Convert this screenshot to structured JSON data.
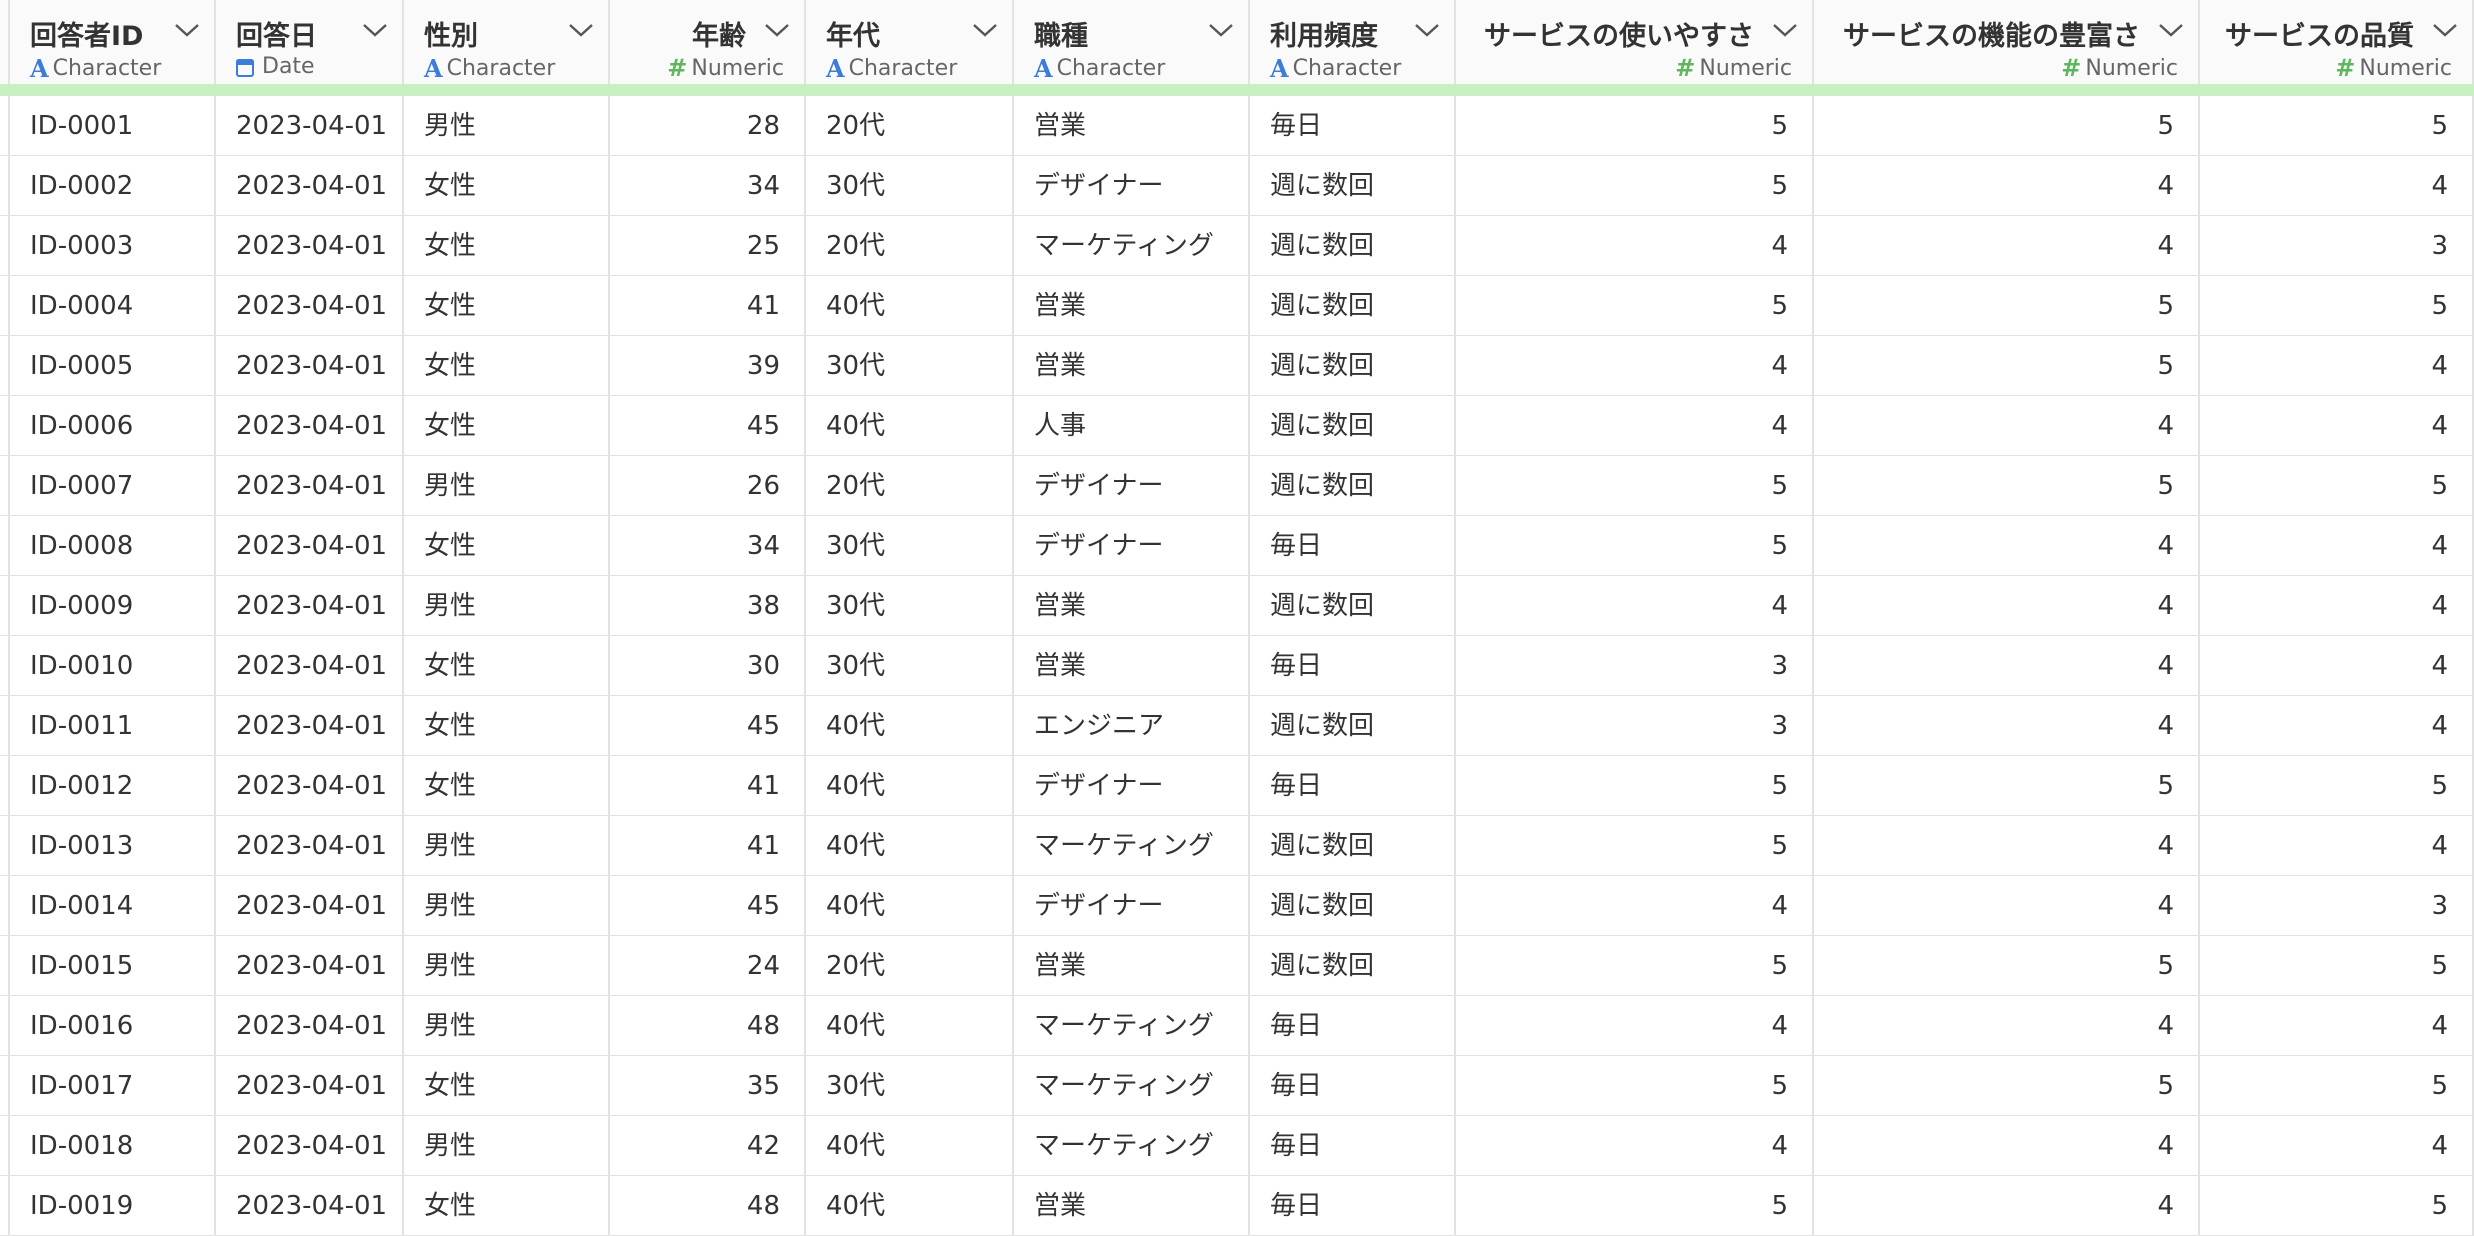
{
  "columns": [
    {
      "name": "回答者ID",
      "type": "Character",
      "icon": "character-icon",
      "align": "left"
    },
    {
      "name": "回答日",
      "type": "Date",
      "icon": "calendar-icon",
      "align": "left"
    },
    {
      "name": "性別",
      "type": "Character",
      "icon": "character-icon",
      "align": "left"
    },
    {
      "name": "年齢",
      "type": "Numeric",
      "icon": "numeric-icon",
      "align": "right"
    },
    {
      "name": "年代",
      "type": "Character",
      "icon": "character-icon",
      "align": "left"
    },
    {
      "name": "職種",
      "type": "Character",
      "icon": "character-icon",
      "align": "left"
    },
    {
      "name": "利用頻度",
      "type": "Character",
      "icon": "character-icon",
      "align": "left"
    },
    {
      "name": "サービスの使いやすさ",
      "type": "Numeric",
      "icon": "numeric-icon",
      "align": "right"
    },
    {
      "name": "サービスの機能の豊富さ",
      "type": "Numeric",
      "icon": "numeric-icon",
      "align": "right"
    },
    {
      "name": "サービスの品質",
      "type": "Numeric",
      "icon": "numeric-icon",
      "align": "right"
    }
  ],
  "type_icons": {
    "Character": "A",
    "Numeric": "#"
  },
  "colors": {
    "character": "#3b7dd8",
    "numeric": "#5db85d",
    "accent": "#c8f0c2"
  },
  "rows": [
    [
      "ID-0001",
      "2023-04-01",
      "男性",
      "28",
      "20代",
      "営業",
      "毎日",
      "5",
      "5",
      "5"
    ],
    [
      "ID-0002",
      "2023-04-01",
      "女性",
      "34",
      "30代",
      "デザイナー",
      "週に数回",
      "5",
      "4",
      "4"
    ],
    [
      "ID-0003",
      "2023-04-01",
      "女性",
      "25",
      "20代",
      "マーケティング",
      "週に数回",
      "4",
      "4",
      "3"
    ],
    [
      "ID-0004",
      "2023-04-01",
      "女性",
      "41",
      "40代",
      "営業",
      "週に数回",
      "5",
      "5",
      "5"
    ],
    [
      "ID-0005",
      "2023-04-01",
      "女性",
      "39",
      "30代",
      "営業",
      "週に数回",
      "4",
      "5",
      "4"
    ],
    [
      "ID-0006",
      "2023-04-01",
      "女性",
      "45",
      "40代",
      "人事",
      "週に数回",
      "4",
      "4",
      "4"
    ],
    [
      "ID-0007",
      "2023-04-01",
      "男性",
      "26",
      "20代",
      "デザイナー",
      "週に数回",
      "5",
      "5",
      "5"
    ],
    [
      "ID-0008",
      "2023-04-01",
      "女性",
      "34",
      "30代",
      "デザイナー",
      "毎日",
      "5",
      "4",
      "4"
    ],
    [
      "ID-0009",
      "2023-04-01",
      "男性",
      "38",
      "30代",
      "営業",
      "週に数回",
      "4",
      "4",
      "4"
    ],
    [
      "ID-0010",
      "2023-04-01",
      "女性",
      "30",
      "30代",
      "営業",
      "毎日",
      "3",
      "4",
      "4"
    ],
    [
      "ID-0011",
      "2023-04-01",
      "女性",
      "45",
      "40代",
      "エンジニア",
      "週に数回",
      "3",
      "4",
      "4"
    ],
    [
      "ID-0012",
      "2023-04-01",
      "女性",
      "41",
      "40代",
      "デザイナー",
      "毎日",
      "5",
      "5",
      "5"
    ],
    [
      "ID-0013",
      "2023-04-01",
      "男性",
      "41",
      "40代",
      "マーケティング",
      "週に数回",
      "5",
      "4",
      "4"
    ],
    [
      "ID-0014",
      "2023-04-01",
      "男性",
      "45",
      "40代",
      "デザイナー",
      "週に数回",
      "4",
      "4",
      "3"
    ],
    [
      "ID-0015",
      "2023-04-01",
      "男性",
      "24",
      "20代",
      "営業",
      "週に数回",
      "5",
      "5",
      "5"
    ],
    [
      "ID-0016",
      "2023-04-01",
      "男性",
      "48",
      "40代",
      "マーケティング",
      "毎日",
      "4",
      "4",
      "4"
    ],
    [
      "ID-0017",
      "2023-04-01",
      "女性",
      "35",
      "30代",
      "マーケティング",
      "毎日",
      "5",
      "5",
      "5"
    ],
    [
      "ID-0018",
      "2023-04-01",
      "男性",
      "42",
      "40代",
      "マーケティング",
      "毎日",
      "4",
      "4",
      "4"
    ],
    [
      "ID-0019",
      "2023-04-01",
      "女性",
      "48",
      "40代",
      "営業",
      "毎日",
      "5",
      "4",
      "5"
    ]
  ]
}
